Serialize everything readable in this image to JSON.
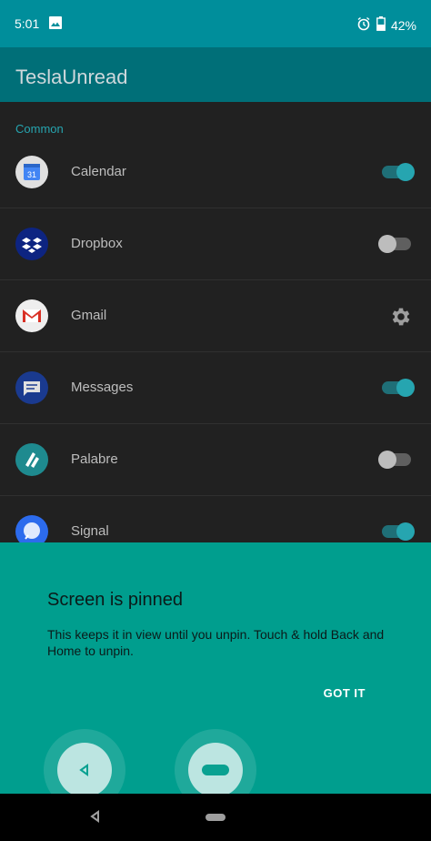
{
  "status": {
    "time": "5:01",
    "battery": "42%"
  },
  "app": {
    "title": "TeslaUnread"
  },
  "section": {
    "header": "Common"
  },
  "apps": [
    {
      "label": "Calendar",
      "toggle": "on"
    },
    {
      "label": "Dropbox",
      "toggle": "off"
    },
    {
      "label": "Gmail",
      "toggle": "settings"
    },
    {
      "label": "Messages",
      "toggle": "on"
    },
    {
      "label": "Palabre",
      "toggle": "off"
    },
    {
      "label": "Signal",
      "toggle": "on"
    }
  ],
  "calendar_icon_text": "31",
  "pin_dialog": {
    "title": "Screen is pinned",
    "body": "This keeps it in view until you unpin. Touch & hold Back and Home to unpin.",
    "action": "GOT IT"
  },
  "colors": {
    "accent": "#26a5b0",
    "status_bar": "#008e9b",
    "app_bar": "#006f78",
    "pin_card": "#009e8e"
  }
}
